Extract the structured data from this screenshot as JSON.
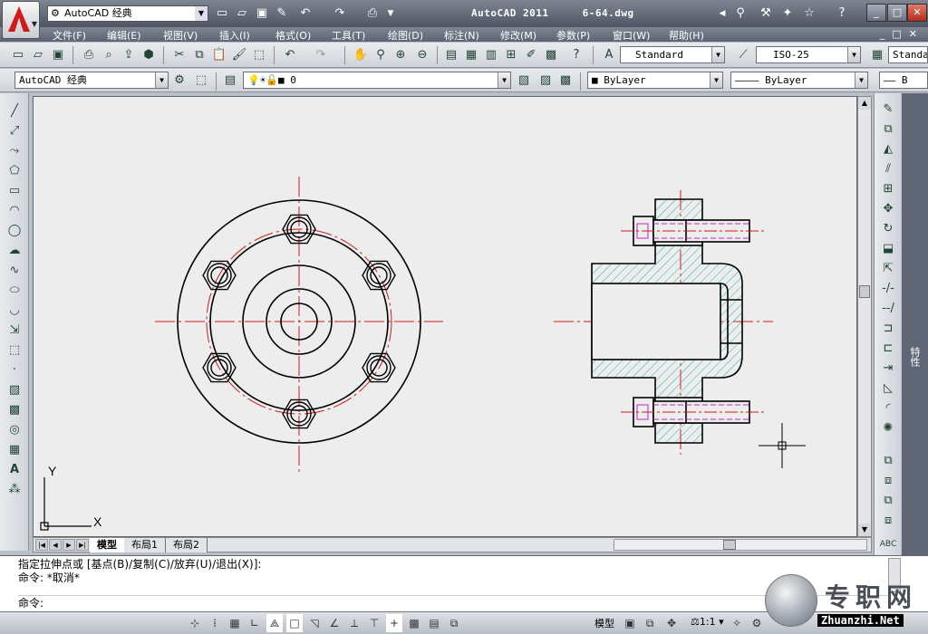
{
  "title_bar": {
    "workspace_quick": "AutoCAD 经典",
    "app_name": "AutoCAD 2011",
    "file_name": "6-64.dwg"
  },
  "menu": [
    "文件(F)",
    "编辑(E)",
    "视图(V)",
    "插入(I)",
    "格式(O)",
    "工具(T)",
    "绘图(D)",
    "标注(N)",
    "修改(M)",
    "参数(P)",
    "窗口(W)",
    "帮助(H)"
  ],
  "styles": {
    "text_style": "Standard",
    "dim_style": "ISO-25",
    "table_style": "Standa"
  },
  "properties": {
    "workspace": "AutoCAD 经典",
    "layer": "0",
    "color": "ByLayer",
    "linetype": "ByLayer",
    "lineweight": "B"
  },
  "layout_tabs": [
    "模型",
    "布局1",
    "布局2"
  ],
  "command": {
    "history": [
      "指定拉伸点或 [基点(B)/复制(C)/放弃(U)/退出(X)]:",
      "命令: *取消*"
    ],
    "prompt": "命令:"
  },
  "status": {
    "model": "模型",
    "annotation_scale": "1:1"
  },
  "palette_label": "特性",
  "ucs": {
    "x": "X",
    "y": "Y"
  },
  "watermark": {
    "title": "专职网",
    "site": "Zhuanzhi.Net"
  },
  "colors": {
    "centerline": "#d01c1c",
    "hatch": "#27b3a8",
    "hidden_line": "#c029c0",
    "canvas": "#ededed"
  }
}
